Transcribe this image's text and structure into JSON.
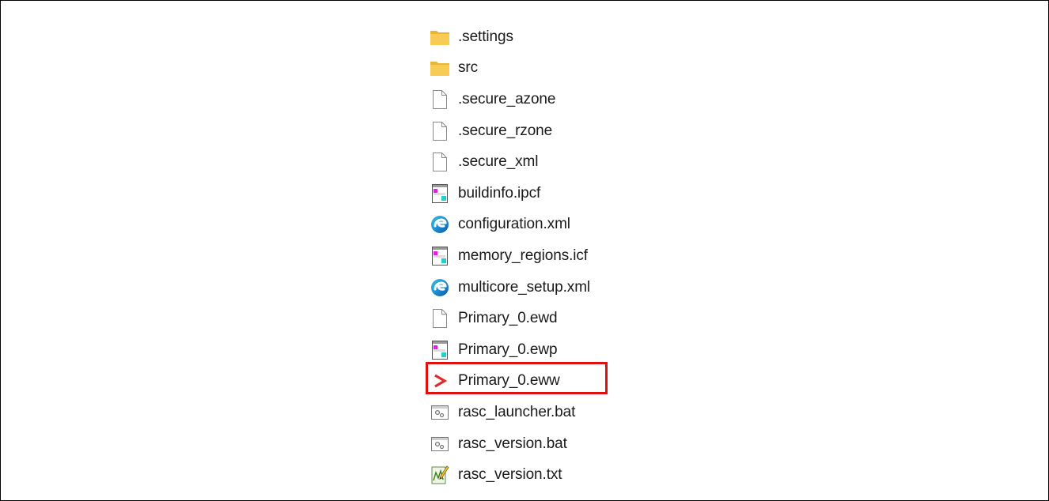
{
  "explorer": {
    "files": [
      {
        "name": ".settings",
        "icon": "folder-icon"
      },
      {
        "name": "src",
        "icon": "folder-icon"
      },
      {
        "name": ".secure_azone",
        "icon": "file-icon"
      },
      {
        "name": ".secure_rzone",
        "icon": "file-icon"
      },
      {
        "name": ".secure_xml",
        "icon": "file-icon"
      },
      {
        "name": "buildinfo.ipcf",
        "icon": "iar-document-icon"
      },
      {
        "name": "configuration.xml",
        "icon": "edge-icon"
      },
      {
        "name": "memory_regions.icf",
        "icon": "iar-document-icon"
      },
      {
        "name": "multicore_setup.xml",
        "icon": "edge-icon"
      },
      {
        "name": "Primary_0.ewd",
        "icon": "file-icon"
      },
      {
        "name": "Primary_0.ewp",
        "icon": "iar-document-icon"
      },
      {
        "name": "Primary_0.eww",
        "icon": "iar-workspace-icon"
      },
      {
        "name": "rasc_launcher.bat",
        "icon": "batch-file-icon"
      },
      {
        "name": "rasc_version.bat",
        "icon": "batch-file-icon"
      },
      {
        "name": "rasc_version.txt",
        "icon": "text-file-icon"
      }
    ],
    "highlighted_file": "Primary_0.eww",
    "highlight_color": "#e01010",
    "folder_color": "#f5c342"
  }
}
